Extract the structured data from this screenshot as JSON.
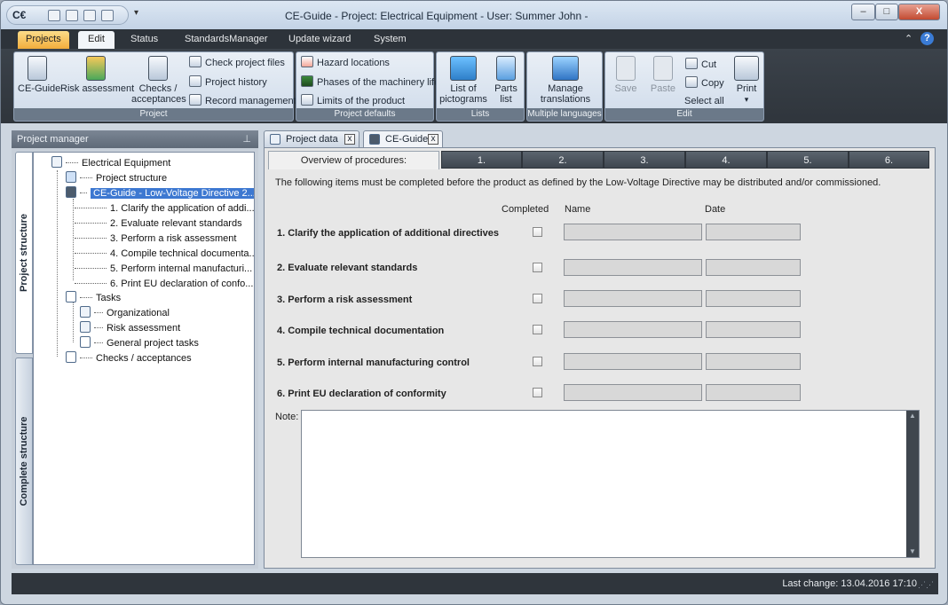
{
  "window": {
    "title": "CE-Guide - Project: Electrical Equipment  -   User: Summer John   -",
    "logo": "C€",
    "controls": {
      "minimize": "–",
      "maximize": "□",
      "close": "X"
    }
  },
  "menu": {
    "tabs": [
      {
        "label": "Projects"
      },
      {
        "label": "Edit"
      },
      {
        "label": "Status"
      },
      {
        "label": "StandardsManager"
      },
      {
        "label": "Update wizard"
      },
      {
        "label": "System"
      }
    ],
    "collapse": "⌃",
    "help": "?"
  },
  "ribbon": {
    "project": {
      "label": "Project",
      "ce_guide": "CE-Guide",
      "risk_assessment": "Risk assessment",
      "checks_1": "Checks /",
      "checks_2": "acceptances",
      "check_files": "Check project files",
      "history": "Project history",
      "records": "Record management"
    },
    "defaults": {
      "label": "Project defaults",
      "hazard": "Hazard locations",
      "phases": "Phases of the machinery life",
      "limits": "Limits of the product"
    },
    "lists": {
      "label": "Lists",
      "pictograms_1": "List of",
      "pictograms_2": "pictograms",
      "parts_1": "Parts",
      "parts_2": "list"
    },
    "languages": {
      "label": "Multiple languages",
      "manage_1": "Manage",
      "manage_2": "translations"
    },
    "edit": {
      "label": "Edit",
      "save": "Save",
      "paste": "Paste",
      "cut": "Cut",
      "copy": "Copy",
      "select_all": "Select all",
      "print": "Print",
      "print_arrow": "▾"
    }
  },
  "project_manager": {
    "title": "Project manager",
    "pin": "⊥",
    "vtabs": {
      "structure": "Project structure",
      "complete": "Complete structure"
    },
    "tree": {
      "root": "Electrical Equipment",
      "structure": "Project structure",
      "ce_guide": "CE-Guide - Low-Voltage Directive 2...",
      "steps": [
        "1. Clarify the application of addi...",
        "2. Evaluate relevant standards",
        "3. Perform a risk assessment",
        "4. Compile technical documenta...",
        "5. Perform internal manufacturi...",
        "6. Print EU declaration of confo..."
      ],
      "tasks": "Tasks",
      "task_items": [
        "Organizational",
        "Risk assessment",
        "General project tasks"
      ],
      "checks": "Checks / acceptances"
    }
  },
  "doc_tabs": {
    "project_data": "Project data",
    "ce_guide": "CE-Guide",
    "close": "x"
  },
  "procedure": {
    "tabs": [
      "Overview of procedures:",
      "1.",
      "2.",
      "3.",
      "4.",
      "5.",
      "6."
    ],
    "intro": "The following items must be completed before the product as defined by the Low-Voltage Directive may be distributed and/or commissioned.",
    "columns": {
      "completed": "Completed",
      "name": "Name",
      "date": "Date"
    },
    "steps": [
      "1. Clarify the application of additional directives",
      "2. Evaluate relevant standards",
      "3. Perform a risk assessment",
      "4. Compile technical documentation",
      "5. Perform internal manufacturing control",
      "6. Print EU declaration of conformity"
    ],
    "note_label": "Note:",
    "scroll_up": "▲",
    "scroll_down": "▼"
  },
  "status": {
    "last_change": "Last change: 13.04.2016 17:10",
    "grip": "⋰⋰"
  }
}
